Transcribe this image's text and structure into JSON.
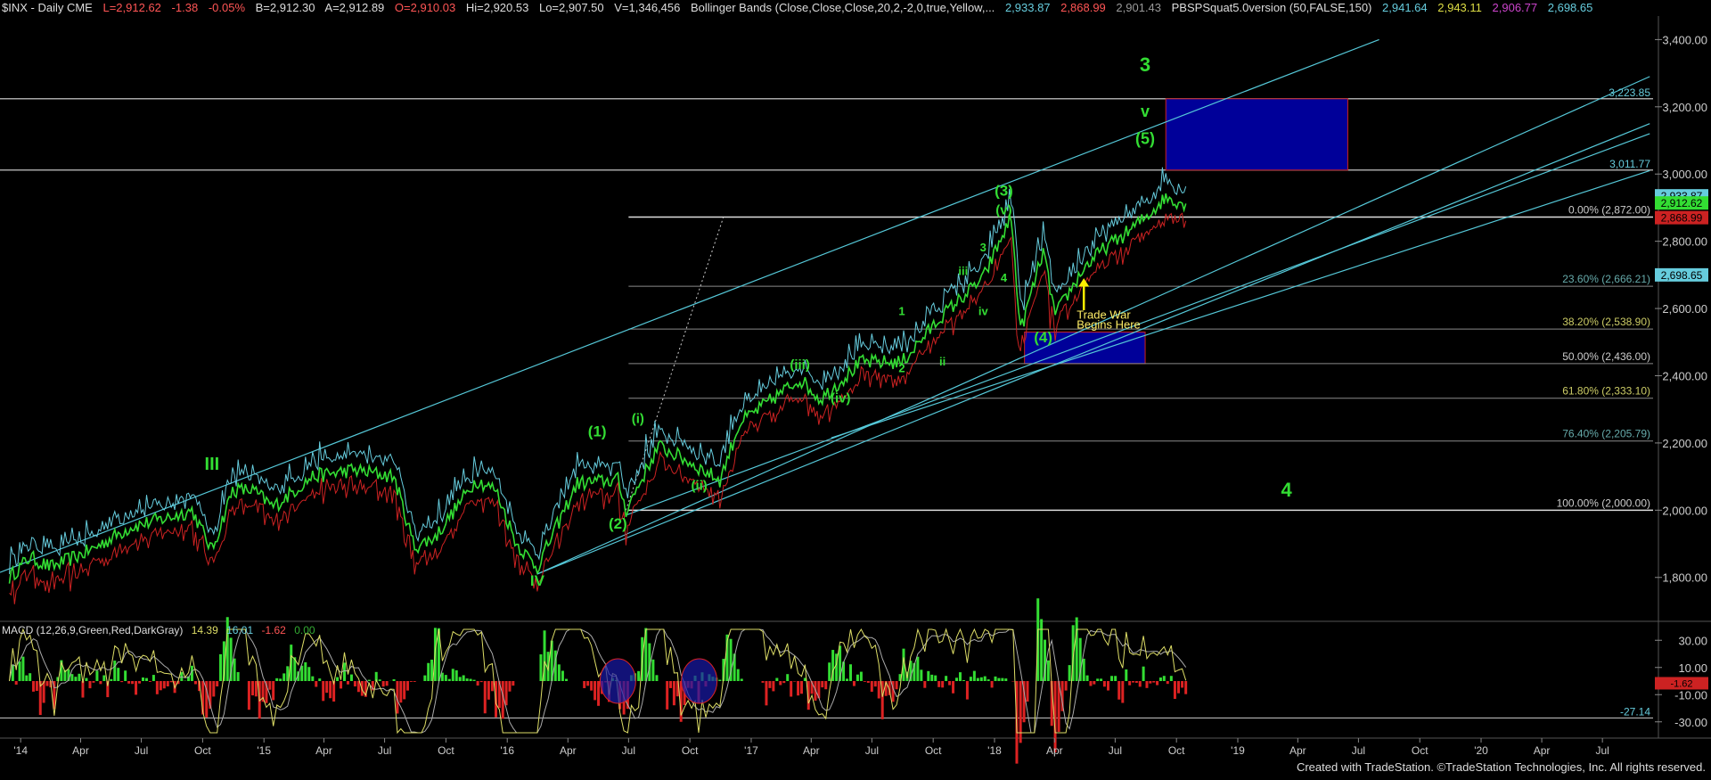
{
  "header": {
    "symbol": "$INX - Daily  CME",
    "last": "L=2,912.62",
    "change": "-1.38",
    "change_pct": "-0.05%",
    "bid": "B=2,912.30",
    "ask": "A=2,912.89",
    "open": "O=2,910.03",
    "high": "Hi=2,920.53",
    "low": "Lo=2,907.50",
    "volume": "V=1,346,456",
    "bb_label": "Bollinger Bands (Close,Close,Close,20,2,-2,0,true,Yellow,...",
    "bb_v1": "2,933.87",
    "bb_v2": "2,868.99",
    "bb_v3": "2,901.43",
    "psq_label": "PBSPSquat5.0version (50,FALSE,150)",
    "psq_v1": "2,941.64",
    "psq_v2": "2,943.11",
    "psq_v3": "2,906.77",
    "psq_v4": "2,698.65"
  },
  "macd_header": {
    "label": "MACD (12,26,9,Green,Red,DarkGray)",
    "v1": "14.39",
    "v2": "16.01",
    "v3": "-1.62",
    "v4": "0.00"
  },
  "credit": "Created with TradeStation. ©TradeStation Technologies, Inc. All rights reserved.",
  "colors": {
    "price": "#33dd33",
    "band_upper": "#66ccdd",
    "band_lower": "#cc2222",
    "channel": "#55c8d8",
    "fib": "#cccccc",
    "box": "#000099",
    "wave": "#33dd33",
    "arrow": "#ffee00",
    "macd": "#dddd66",
    "signal": "#aaaaaa"
  },
  "chart_data": {
    "type": "line",
    "title": "$INX - Daily",
    "x_axis_labels": [
      "'14",
      "Apr",
      "Jul",
      "Oct",
      "'15",
      "Apr",
      "Jul",
      "Oct",
      "'16",
      "Apr",
      "Jul",
      "Oct",
      "'17",
      "Apr",
      "Jul",
      "Oct",
      "'18",
      "Apr",
      "Jul",
      "Oct",
      "'19",
      "Apr",
      "Jul",
      "Oct",
      "'20",
      "Apr",
      "Jul"
    ],
    "y_ticks": [
      1800,
      2000,
      2200,
      2400,
      2600,
      2800,
      3000,
      3200,
      3400
    ],
    "ylim": [
      1680,
      3470
    ],
    "series": [
      {
        "name": "$INX",
        "points": [
          [
            "2013-12",
            1800
          ],
          [
            "2014-01",
            1860
          ],
          [
            "2014-02",
            1830
          ],
          [
            "2014-04",
            1880
          ],
          [
            "2014-06",
            1950
          ],
          [
            "2014-08",
            1980
          ],
          [
            "2014-09",
            2000
          ],
          [
            "2014-10",
            1880
          ],
          [
            "2014-11",
            2060
          ],
          [
            "2014-12",
            2060
          ],
          [
            "2015-01",
            2010
          ],
          [
            "2015-03",
            2100
          ],
          [
            "2015-05",
            2120
          ],
          [
            "2015-07",
            2100
          ],
          [
            "2015-08",
            1890
          ],
          [
            "2015-09",
            1920
          ],
          [
            "2015-11",
            2090
          ],
          [
            "2015-12",
            2060
          ],
          [
            "2016-01",
            1900
          ],
          [
            "2016-02",
            1830
          ],
          [
            "2016-04",
            2080
          ],
          [
            "2016-06",
            2090
          ],
          [
            "2016-06-27",
            2000
          ],
          [
            "2016-08",
            2190
          ],
          [
            "2016-09",
            2160
          ],
          [
            "2016-11",
            2090
          ],
          [
            "2016-12",
            2260
          ],
          [
            "2017-03",
            2390
          ],
          [
            "2017-04",
            2330
          ],
          [
            "2017-06",
            2440
          ],
          [
            "2017-08",
            2440
          ],
          [
            "2017-10",
            2580
          ],
          [
            "2017-12",
            2690
          ],
          [
            "2018-01-26",
            2872
          ],
          [
            "2018-02-09",
            2532
          ],
          [
            "2018-03",
            2770
          ],
          [
            "2018-04-02",
            2580
          ],
          [
            "2018-05",
            2720
          ],
          [
            "2018-06",
            2780
          ],
          [
            "2018-07",
            2820
          ],
          [
            "2018-08",
            2870
          ],
          [
            "2018-09",
            2930
          ],
          [
            "2018-10",
            2912
          ]
        ]
      }
    ],
    "fib_levels": [
      {
        "label": "0.00% (2,872.00)",
        "value": 2872
      },
      {
        "label": "23.60% (2,666.21)",
        "value": 2666.21
      },
      {
        "label": "38.20% (2,538.90)",
        "value": 2538.9
      },
      {
        "label": "50.00% (2,436.00)",
        "value": 2436
      },
      {
        "label": "61.80% (2,333.10)",
        "value": 2333.1
      },
      {
        "label": "76.40% (2,205.79)",
        "value": 2205.79
      },
      {
        "label": "100.00% (2,000.00)",
        "value": 2000
      }
    ],
    "horizontal_levels": [
      {
        "label": "3,223.85",
        "value": 3223.85
      },
      {
        "label": "3,011.77",
        "value": 3011.77
      }
    ],
    "right_tags": [
      {
        "label": "2,933.87",
        "value": 2933.87,
        "color": "#66ccdd"
      },
      {
        "label": "2,912.62",
        "value": 2912.62,
        "color": "#33dd33"
      },
      {
        "label": "2,868.99",
        "value": 2868.99,
        "color": "#cc2222"
      },
      {
        "label": "2,698.65",
        "value": 2698.65,
        "color": "#66ccdd"
      }
    ],
    "target_boxes": [
      {
        "from": "2018-09",
        "to": "2019-06",
        "low": 3011.77,
        "high": 3223.85
      },
      {
        "from": "2018-02",
        "to": "2018-08",
        "low": 2436,
        "high": 2530
      }
    ],
    "wave_labels": [
      {
        "text": "III",
        "x": "2014-10",
        "y": 2120,
        "size": 20
      },
      {
        "text": "IV",
        "x": "2016-02",
        "y": 1775,
        "size": 17
      },
      {
        "text": "(1)",
        "x": "2016-05",
        "y": 2220,
        "size": 17
      },
      {
        "text": "(2)",
        "x": "2016-06",
        "y": 1945,
        "size": 17
      },
      {
        "text": "(i)",
        "x": "2016-07",
        "y": 2260,
        "size": 15
      },
      {
        "text": "(ii)",
        "x": "2016-10",
        "y": 2060,
        "size": 15
      },
      {
        "text": "(iii)",
        "x": "2017-03",
        "y": 2420,
        "size": 15
      },
      {
        "text": "(iv)",
        "x": "2017-05",
        "y": 2320,
        "size": 15
      },
      {
        "text": "(3)",
        "x": "2018-01",
        "y": 2935,
        "size": 17
      },
      {
        "text": "(v)",
        "x": "2018-01",
        "y": 2880,
        "size": 15
      },
      {
        "text": "(4)",
        "x": "2018-03",
        "y": 2500,
        "size": 17
      },
      {
        "text": "1",
        "x": "2017-08",
        "y": 2580,
        "size": 13
      },
      {
        "text": "2",
        "x": "2017-08",
        "y": 2410,
        "size": 13
      },
      {
        "text": "3",
        "x": "2017-12",
        "y": 2770,
        "size": 13
      },
      {
        "text": "4",
        "x": "2018-01",
        "y": 2680,
        "size": 13
      },
      {
        "text": "iii",
        "x": "2017-11",
        "y": 2700,
        "size": 13
      },
      {
        "text": "iv",
        "x": "2017-12",
        "y": 2580,
        "size": 13
      },
      {
        "text": "ii",
        "x": "2017-10",
        "y": 2430,
        "size": 13
      },
      {
        "text": "3",
        "x": "2018-08",
        "y": 3305,
        "size": 22
      },
      {
        "text": "v",
        "x": "2018-08",
        "y": 3170,
        "size": 18
      },
      {
        "text": "(5)",
        "x": "2018-08",
        "y": 3090,
        "size": 18
      },
      {
        "text": "4",
        "x": "2019-03",
        "y": 2040,
        "size": 22
      }
    ],
    "annotations": [
      {
        "text": "Trade War",
        "x": "2018-05",
        "y": 2570
      },
      {
        "text": "Begins Here",
        "x": "2018-05",
        "y": 2540
      }
    ]
  },
  "macd_chart": {
    "y_ticks": [
      30,
      10,
      -10,
      -30
    ],
    "level_tags": [
      {
        "label": "-27.14",
        "value": -27.14
      },
      {
        "label": "-1.62",
        "value": -1.62
      }
    ]
  }
}
